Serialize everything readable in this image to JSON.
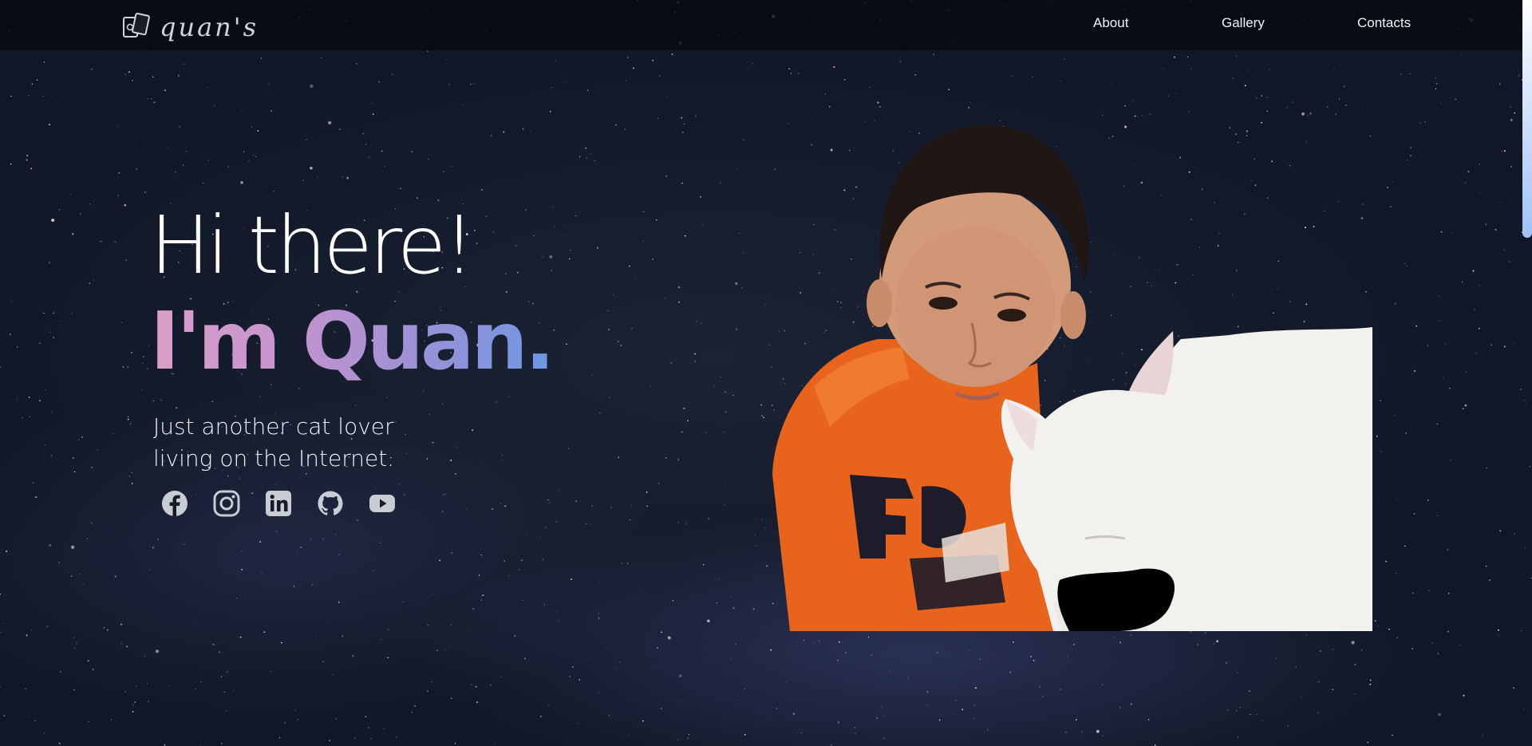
{
  "header": {
    "logo_text": "quan's",
    "logo_icon": "cards-icon",
    "nav": [
      {
        "label": "About"
      },
      {
        "label": "Gallery"
      },
      {
        "label": "Contacts"
      }
    ]
  },
  "hero": {
    "greeting": "Hi there!",
    "name_line": "I'm Quan.",
    "tagline_line1": "Just another cat lover",
    "tagline_line2": "living on the Internet.",
    "social": [
      {
        "icon": "facebook-icon"
      },
      {
        "icon": "instagram-icon"
      },
      {
        "icon": "linkedin-icon"
      },
      {
        "icon": "github-icon"
      },
      {
        "icon": "youtube-icon"
      }
    ]
  },
  "colors": {
    "gradient_start": "#d9a0c9",
    "gradient_end": "#6e97e3",
    "shirt": "#e8641c",
    "cat": "#f3f1ee"
  }
}
